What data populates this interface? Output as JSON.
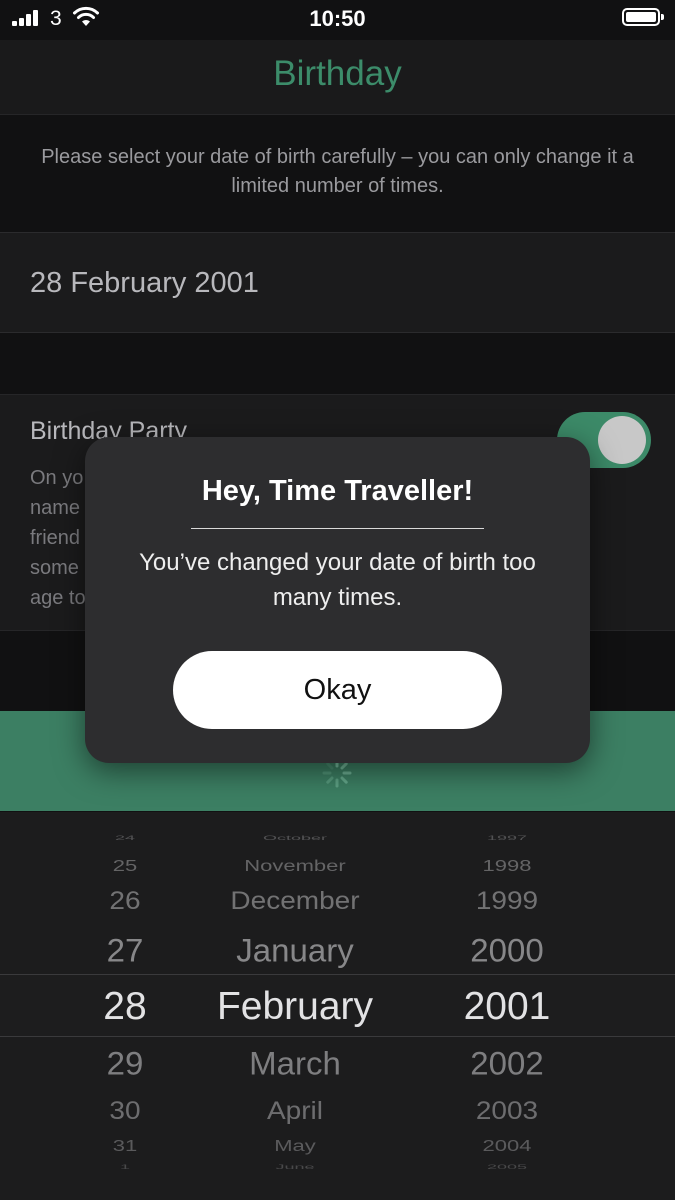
{
  "status_bar": {
    "carrier": "3",
    "time": "10:50"
  },
  "nav": {
    "title": "Birthday"
  },
  "note": {
    "text": "Please select your date of birth carefully – you can only change it a limited number of times."
  },
  "birth_date": {
    "value": "28 February 2001"
  },
  "party": {
    "title": "Birthday Party",
    "description_visible": [
      "On yo",
      "name",
      "friend",
      "some",
      "age to"
    ],
    "toggle_on": true
  },
  "picker": {
    "days": [
      "24",
      "25",
      "26",
      "27",
      "28",
      "29",
      "30",
      "31",
      "1"
    ],
    "months": [
      "October",
      "November",
      "December",
      "January",
      "February",
      "March",
      "April",
      "May",
      "June"
    ],
    "years": [
      "1997",
      "1998",
      "1999",
      "2000",
      "2001",
      "2002",
      "2003",
      "2004",
      "2005"
    ],
    "selected": {
      "day": "28",
      "month": "February",
      "year": "2001"
    }
  },
  "modal": {
    "title": "Hey, Time Traveller!",
    "message": "You’ve changed your date of birth too many times.",
    "button_label": "Okay"
  },
  "colors": {
    "accent": "#3c8c6a",
    "save_bar": "#3c7f63",
    "background": "#111112"
  }
}
